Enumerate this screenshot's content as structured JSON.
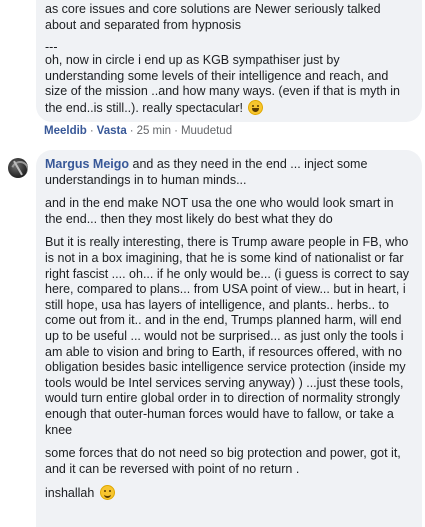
{
  "comment1": {
    "text_lines": [
      "as core issues and core solutions are Newer seriously talked about and separated from hypnosis",
      "---",
      "oh, now in circle i end up as KGB sympathiser just by understanding some levels of their intelligence and reach, and size of the mission ..and how many ways. (even if that is myth in the end..is still..). really spectacular!"
    ],
    "emoji_icon": "grinning-squinting-face",
    "actions": {
      "like_label": "Meeldib",
      "reply_label": "Vasta",
      "time": "25 min",
      "edited": "Muudetud",
      "separator": "·"
    }
  },
  "comment2": {
    "author": "Margus Meigo",
    "first_paragraph_after_author": " and as they need in the end ... inject some understandings in to human minds...",
    "paragraphs": [
      "and in the end make NOT usa the one who would look smart in the end... then they most likely do best what they do",
      "But it is really interesting, there is Trump aware people in FB, who is not in a box imagining, that he is some kind of nationalist or far right fascist .... oh... if he only would be... (i guess is correct to say here, compared to plans... from USA point of view... but in heart, i still hope, usa has layers of intelligence, and plants.. herbs.. to come out from it.. and in the end, Trumps planned harm, will end up to be useful ... would not be surprised... as just only the tools i am able to vision and bring to Earth, if resources offered, with no obligation besides basic intelligence service protection (inside my tools would be Intel services serving anyway) ) ...just these tools, would turn entire global order in to direction of normality strongly enough that outer-human forces would have to fallow, or take a knee",
      "some forces that do not need so big protection and power, got it, and it can be reversed with point of no return ."
    ],
    "closing": "inshallah",
    "closing_emoji_icon": "slightly-smiling-face"
  }
}
